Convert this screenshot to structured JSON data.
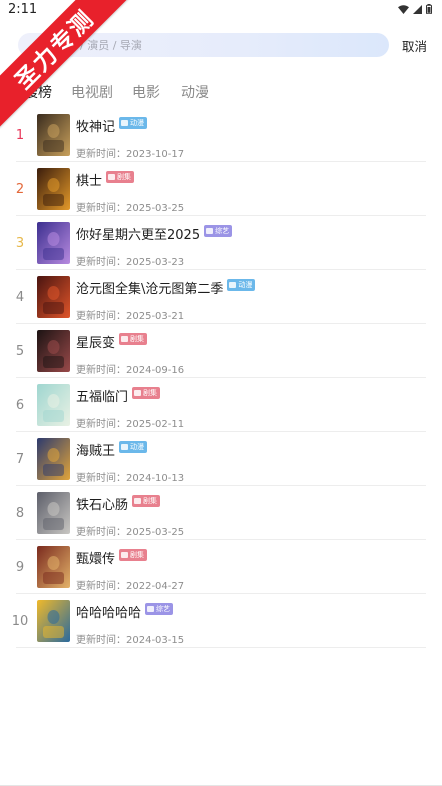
{
  "status_bar": {
    "time": "2:11",
    "icons": [
      "wifi-icon",
      "cell-signal-icon",
      "battery-icon"
    ]
  },
  "watermark": {
    "text": "圣力专测"
  },
  "search": {
    "placeholder": "/ 演员 / 导演",
    "cancel_label": "取消"
  },
  "tabs": [
    {
      "label": "热搜榜",
      "active": true
    },
    {
      "label": "电视剧",
      "active": false
    },
    {
      "label": "电影",
      "active": false
    },
    {
      "label": "动漫",
      "active": false
    }
  ],
  "rank_colors": {
    "1": "#e8385a",
    "2": "#e3683a",
    "3": "#e7b84a",
    "default": "#8a8a8a"
  },
  "badge_colors": {
    "动漫": "#6bb8ea",
    "剧集": "#e8808e",
    "综艺": "#9b94e6"
  },
  "items": [
    {
      "rank": "1",
      "title": "牧神记",
      "badge": "动漫",
      "update": "更新时间：2023-10-17",
      "poster_colors": [
        "#3a2c1e",
        "#c9a15c"
      ]
    },
    {
      "rank": "2",
      "title": "棋士",
      "badge": "剧集",
      "update": "更新时间：2025-03-25",
      "poster_colors": [
        "#3b1d0c",
        "#e49a2a"
      ]
    },
    {
      "rank": "3",
      "title": "你好星期六更至2025",
      "badge": "综艺",
      "update": "更新时间：2025-03-23",
      "poster_colors": [
        "#3c2f8f",
        "#b88be0"
      ]
    },
    {
      "rank": "4",
      "title": "沧元图全集\\沧元图第二季",
      "badge": "动漫",
      "update": "更新时间：2025-03-21",
      "poster_colors": [
        "#4a1410",
        "#e0552a"
      ]
    },
    {
      "rank": "5",
      "title": "星辰变",
      "badge": "剧集",
      "update": "更新时间：2024-09-16",
      "poster_colors": [
        "#1c1313",
        "#9a4a4a"
      ]
    },
    {
      "rank": "6",
      "title": "五福临门",
      "badge": "剧集",
      "update": "更新时间：2025-02-11",
      "poster_colors": [
        "#9fd6d0",
        "#e9f1e4"
      ]
    },
    {
      "rank": "7",
      "title": "海贼王",
      "badge": "动漫",
      "update": "更新时间：2024-10-13",
      "poster_colors": [
        "#2c3a6e",
        "#e2a53a"
      ]
    },
    {
      "rank": "8",
      "title": "铁石心肠",
      "badge": "剧集",
      "update": "更新时间：2025-03-25",
      "poster_colors": [
        "#5d5f6a",
        "#c9c7c3"
      ]
    },
    {
      "rank": "9",
      "title": "甄嬛传",
      "badge": "剧集",
      "update": "更新时间：2022-04-27",
      "poster_colors": [
        "#7a2a1e",
        "#e4b36a"
      ]
    },
    {
      "rank": "10",
      "title": "哈哈哈哈哈",
      "badge": "综艺",
      "update": "更新时间：2024-03-15",
      "poster_colors": [
        "#f0b92a",
        "#2a6a9e"
      ]
    }
  ]
}
